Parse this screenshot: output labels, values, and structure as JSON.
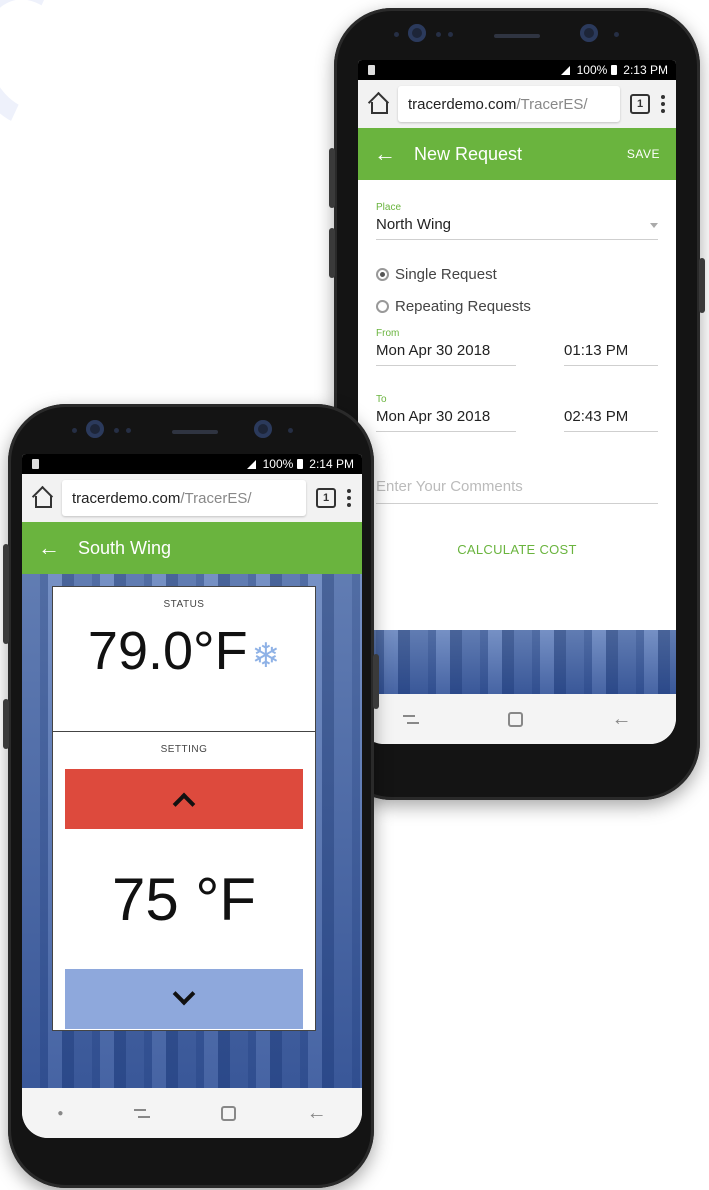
{
  "request_phone": {
    "statusbar": {
      "battery": "100%",
      "time": "2:13 PM"
    },
    "browser": {
      "url_host": "tracerdemo.com",
      "url_path": "/TracerES/",
      "tab_count": "1"
    },
    "appbar": {
      "title": "New Request",
      "action": "SAVE"
    },
    "form": {
      "place_label": "Place",
      "place_value": "North Wing",
      "radio_single": "Single Request",
      "radio_repeating": "Repeating Requests",
      "from_label": "From",
      "from_date": "Mon Apr 30 2018",
      "from_time": "01:13 PM",
      "to_label": "To",
      "to_date": "Mon Apr 30 2018",
      "to_time": "02:43 PM",
      "comments_placeholder": "Enter Your Comments",
      "calculate_label": "CALCULATE COST"
    }
  },
  "thermostat_phone": {
    "statusbar": {
      "battery": "100%",
      "time": "2:14 PM"
    },
    "browser": {
      "url_host": "tracerdemo.com",
      "url_path": "/TracerES/",
      "tab_count": "1"
    },
    "appbar": {
      "title": "South Wing"
    },
    "status": {
      "label": "STATUS",
      "temperature": "79.0°F",
      "mode_icon": "snowflake-icon"
    },
    "setting": {
      "label": "SETTING",
      "temperature": "75 °F"
    }
  },
  "colors": {
    "accent_green": "#6ab43e",
    "up_red": "#dd4a3d",
    "down_blue": "#8ea8dc"
  }
}
